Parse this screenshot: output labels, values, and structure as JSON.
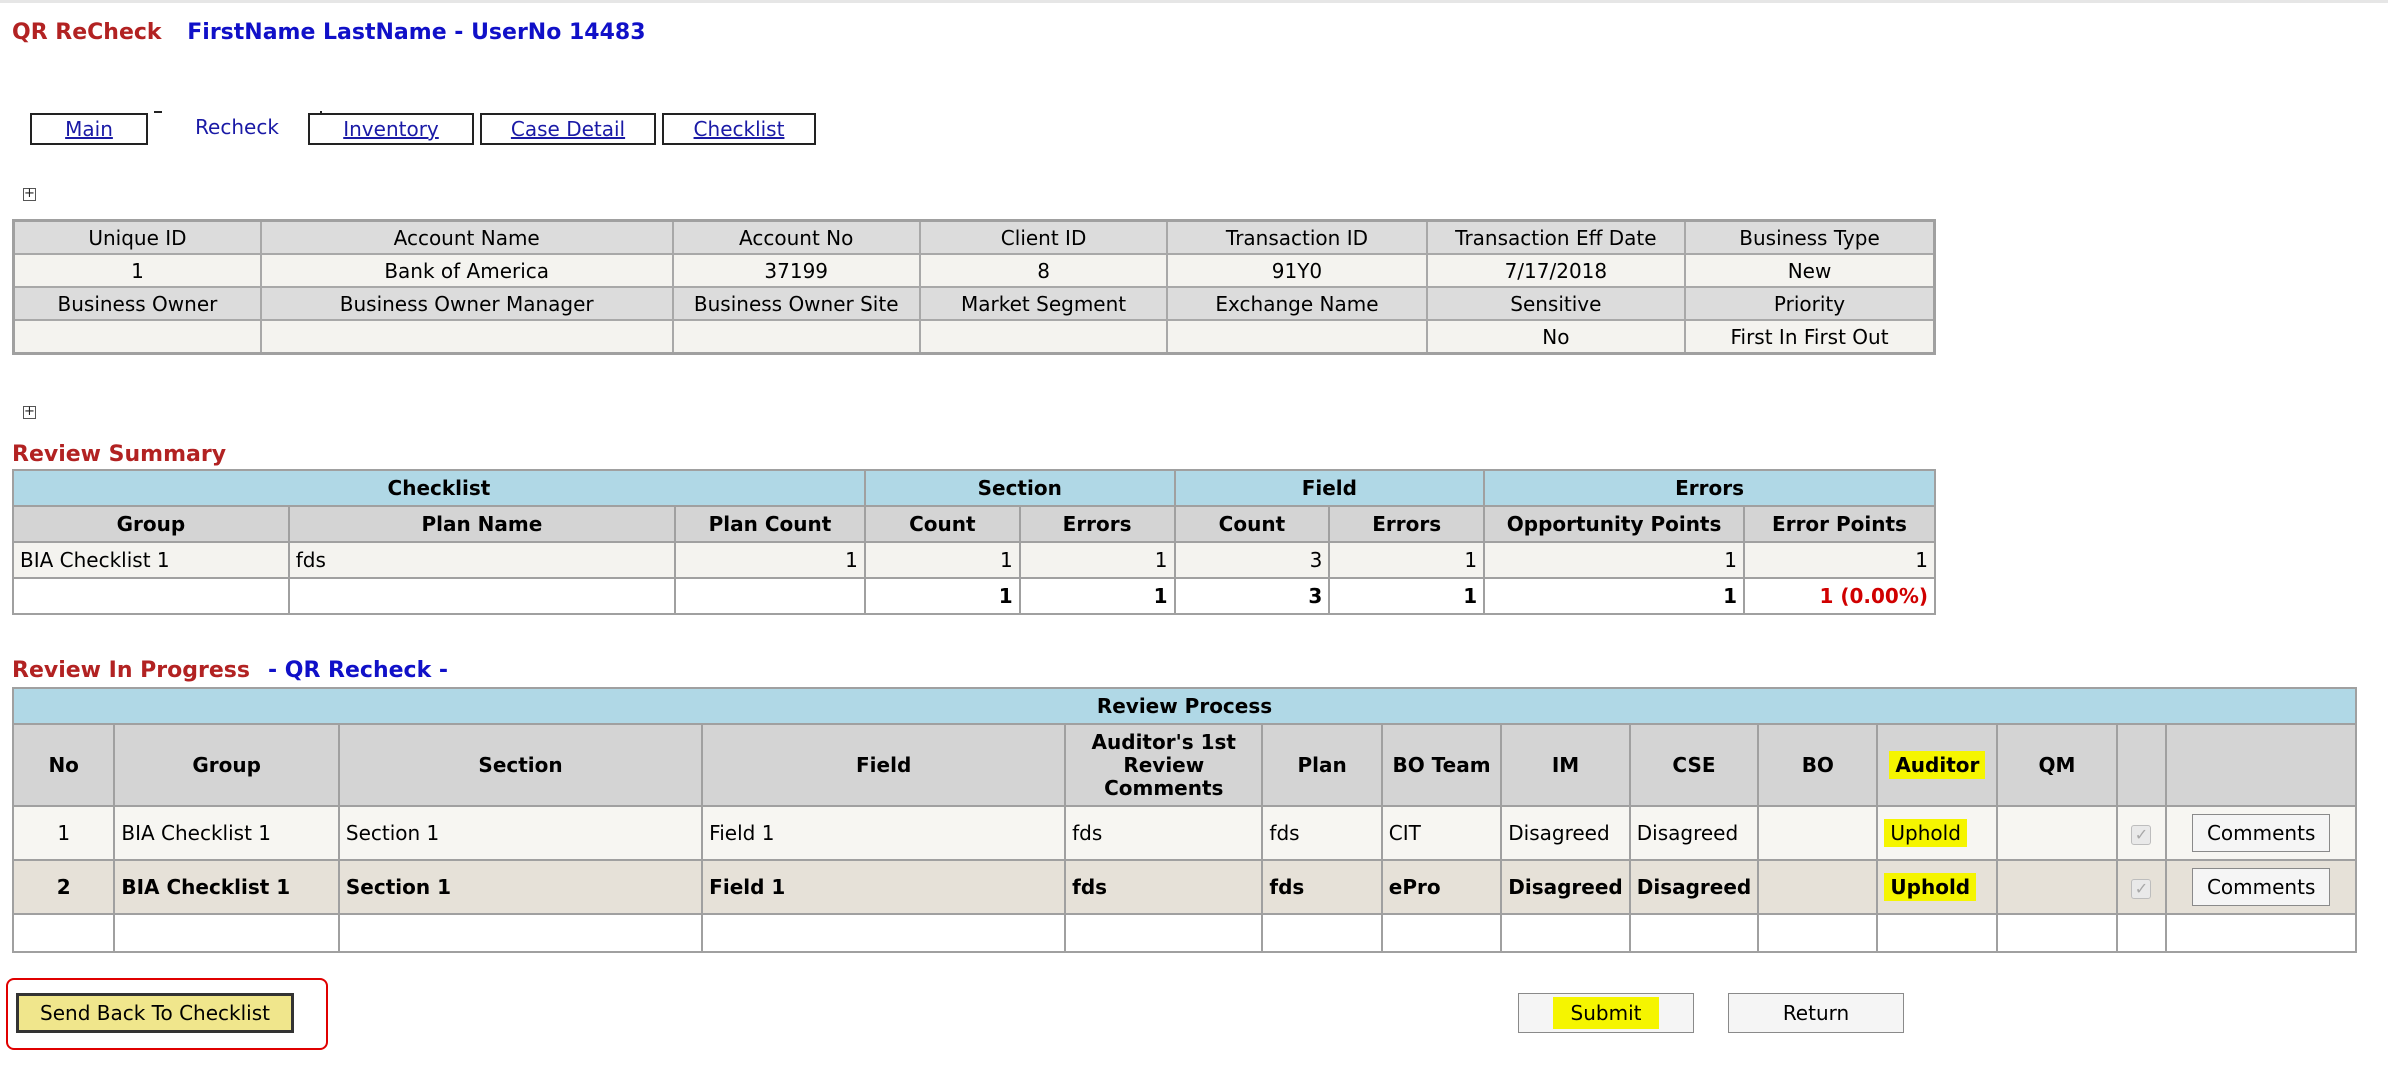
{
  "header": {
    "app_title": "QR ReCheck",
    "user_info": "FirstName LastName - UserNo 14483"
  },
  "tabs": [
    {
      "label": "Main",
      "active": false
    },
    {
      "label": "Recheck",
      "active": true
    },
    {
      "label": "Inventory",
      "active": false
    },
    {
      "label": "Case Detail",
      "active": false
    },
    {
      "label": "Checklist",
      "active": false
    }
  ],
  "info": {
    "row1_headers": [
      "Unique ID",
      "Account Name",
      "Account No",
      "Client ID",
      "Transaction ID",
      "Transaction Eff Date",
      "Business Type"
    ],
    "row1_values": [
      "1",
      "Bank of America",
      "37199",
      "8",
      "91Y0",
      "7/17/2018",
      "New"
    ],
    "row2_headers": [
      "Business Owner",
      "Business Owner Manager",
      "Business Owner Site",
      "Market Segment",
      "Exchange Name",
      "Sensitive",
      "Priority"
    ],
    "row2_values": [
      "",
      "",
      "",
      "",
      "",
      "No",
      "First In First Out"
    ]
  },
  "review_summary": {
    "title": "Review Summary",
    "groups": [
      "Checklist",
      "Section",
      "Field",
      "Errors"
    ],
    "columns": [
      "Group",
      "Plan Name",
      "Plan Count",
      "Count",
      "Errors",
      "Count",
      "Errors",
      "Opportunity Points",
      "Error Points"
    ],
    "rows": [
      [
        "BIA Checklist 1",
        "fds",
        "1",
        "1",
        "1",
        "3",
        "1",
        "1",
        "1"
      ]
    ],
    "totals": [
      "",
      "",
      "",
      "1",
      "1",
      "3",
      "1",
      "1",
      "1 (0.00%)"
    ]
  },
  "review_in_progress": {
    "title": "Review In Progress",
    "subtitle": "- QR Recheck -",
    "table_title": "Review Process",
    "columns": [
      "No",
      "Group",
      "Section",
      "Field",
      "Auditor's 1st Review Comments",
      "Plan",
      "BO Team",
      "IM",
      "CSE",
      "BO",
      "Auditor",
      "QM",
      "",
      ""
    ],
    "rows": [
      {
        "no": "1",
        "group": "BIA Checklist 1",
        "section": "Section 1",
        "field": "Field 1",
        "comments": "fds",
        "plan": "fds",
        "bo_team": "CIT",
        "im": "Disagreed",
        "cse": "Disagreed",
        "bo": "",
        "auditor": "Uphold",
        "qm": "",
        "checked": true,
        "button": "Comments"
      },
      {
        "no": "2",
        "group": "BIA Checklist 1",
        "section": "Section 1",
        "field": "Field 1",
        "comments": "fds",
        "plan": "fds",
        "bo_team": "ePro",
        "im": "Disagreed",
        "cse": "Disagreed",
        "bo": "",
        "auditor": "Uphold",
        "qm": "",
        "checked": true,
        "button": "Comments"
      }
    ]
  },
  "buttons": {
    "send_back": "Send Back To Checklist",
    "submit": "Submit",
    "return": "Return"
  },
  "colors": {
    "title_red": "#b22222",
    "user_blue": "#1010c8",
    "header_blue": "#b0d8e6",
    "highlight_yellow": "#f5f500",
    "annotation_red": "#e00000"
  }
}
